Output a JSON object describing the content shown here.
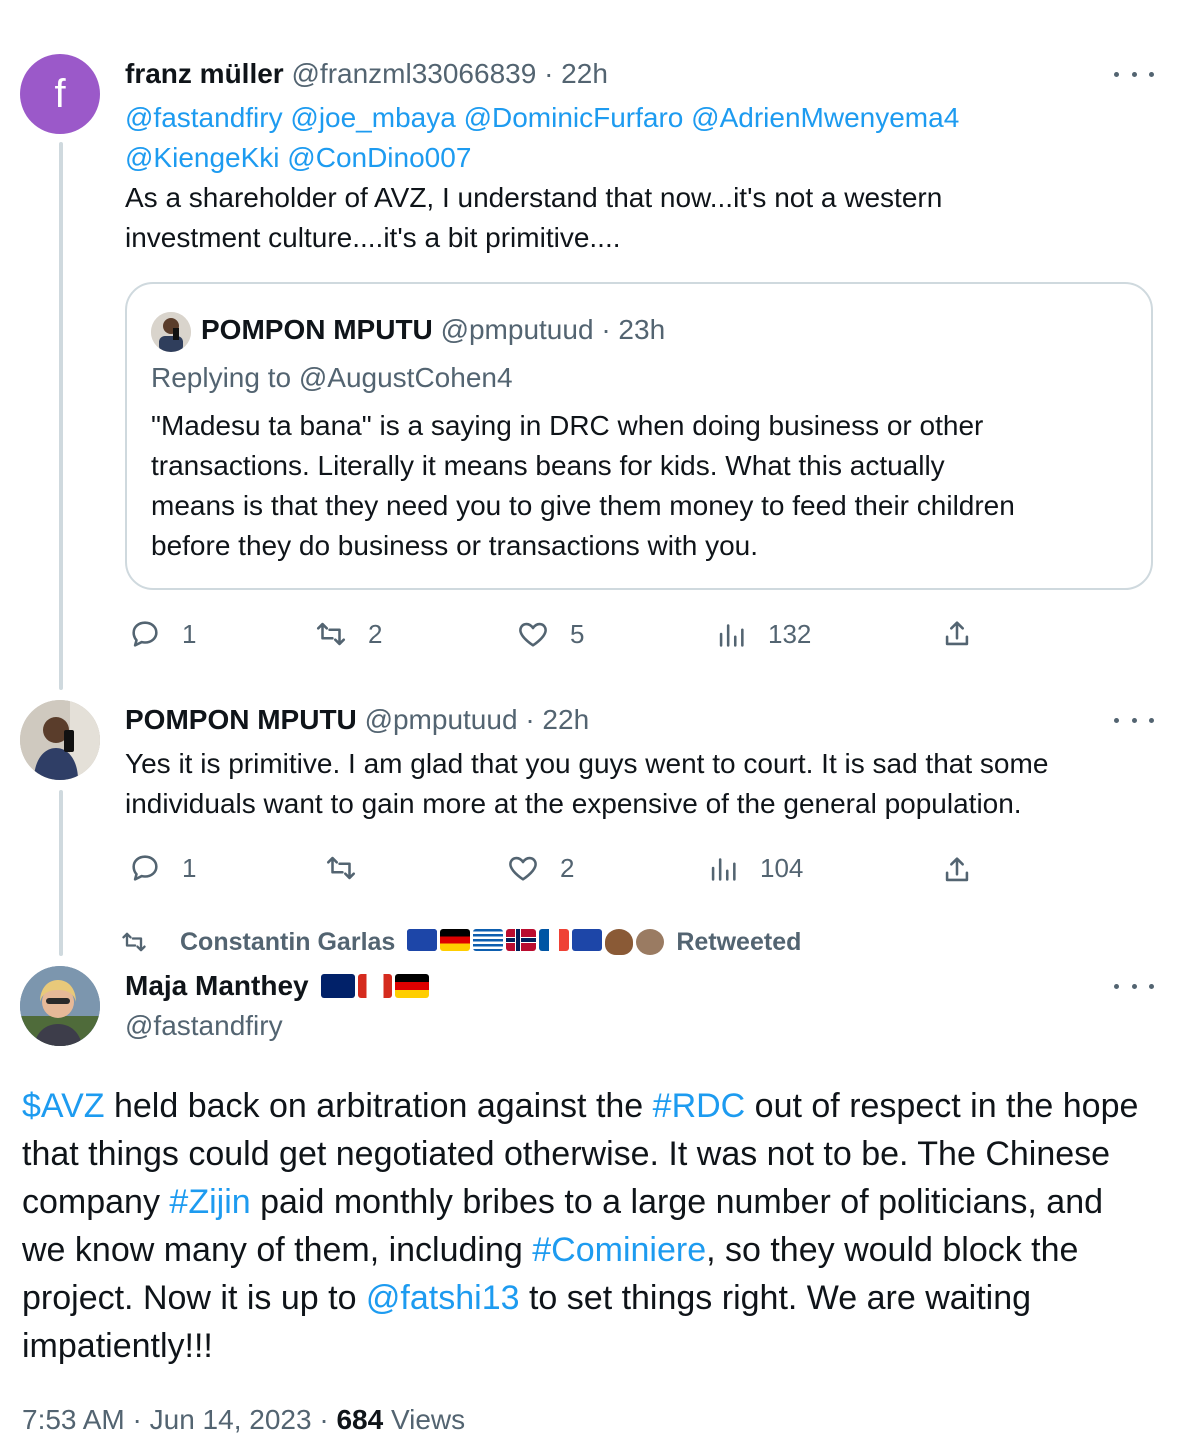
{
  "tweet1": {
    "avatar_letter": "f",
    "name": "franz müller",
    "handle": "@franzml33066839",
    "time": "22h",
    "mentions_line1": [
      "@fastandfiry",
      "@joe_mbaya",
      "@DominicFurfaro",
      "@AdrienMwenyema4"
    ],
    "mentions_line2": [
      "@KiengeKki",
      "@ConDino007"
    ],
    "text_line1": "As a shareholder of AVZ, I understand that now...it's not a western",
    "text_line2": "investment culture....it's a bit primitive....",
    "quote": {
      "name": "POMPON MPUTU",
      "handle": "@pmputuud",
      "time": "23h",
      "replying_to": "Replying to @AugustCohen4",
      "lines": [
        "\"Madesu ta bana\" is a saying in DRC when doing business or other",
        "transactions. Literally it means beans for kids. What this  actually",
        "means is that they need you  to give them money to feed  their children",
        "before they do business or transactions with you."
      ]
    },
    "actions": {
      "replies": "1",
      "retweets": "2",
      "likes": "5",
      "views": "132"
    }
  },
  "tweet2": {
    "name": "POMPON MPUTU",
    "handle": "@pmputuud",
    "time": "22h",
    "text_line1": "Yes it is primitive. I am glad that you guys went to  court. It is sad that some",
    "text_line2": "individuals want to gain more at the expensive of the general population.",
    "actions": {
      "replies": "1",
      "retweets": "",
      "likes": "2",
      "views": "104"
    }
  },
  "retweet_banner": {
    "retweeter": "Constantin Garlas",
    "label": "Retweeted"
  },
  "main_tweet": {
    "name": "Maja Manthey",
    "handle": "@fastandfiry",
    "segments": [
      {
        "t": "$AVZ",
        "link": true
      },
      {
        "t": " held back on arbitration against the ",
        "link": false
      },
      {
        "t": "#RDC",
        "link": true
      },
      {
        "t": " out of respect in the hope that things could get negotiated otherwise. It was not to be. The Chinese company ",
        "link": false
      },
      {
        "t": "#Zijin",
        "link": true
      },
      {
        "t": " paid monthly bribes to a large number of politicians, and we know many of them, including ",
        "link": false
      },
      {
        "t": "#Cominiere",
        "link": true
      },
      {
        "t": ", so they would block the project. Now it is up to ",
        "link": false
      },
      {
        "t": "@fatshi13",
        "link": true
      },
      {
        "t": " to set things right. We are waiting impatiently!!!",
        "link": false
      }
    ],
    "time": "7:53 AM",
    "date": "Jun 14, 2023",
    "views_count": "684",
    "views_label": "Views"
  },
  "colors": {
    "link": "#1d9bf0",
    "muted": "#536471",
    "text": "#0f1419",
    "avatar_f": "#9b59c9"
  }
}
